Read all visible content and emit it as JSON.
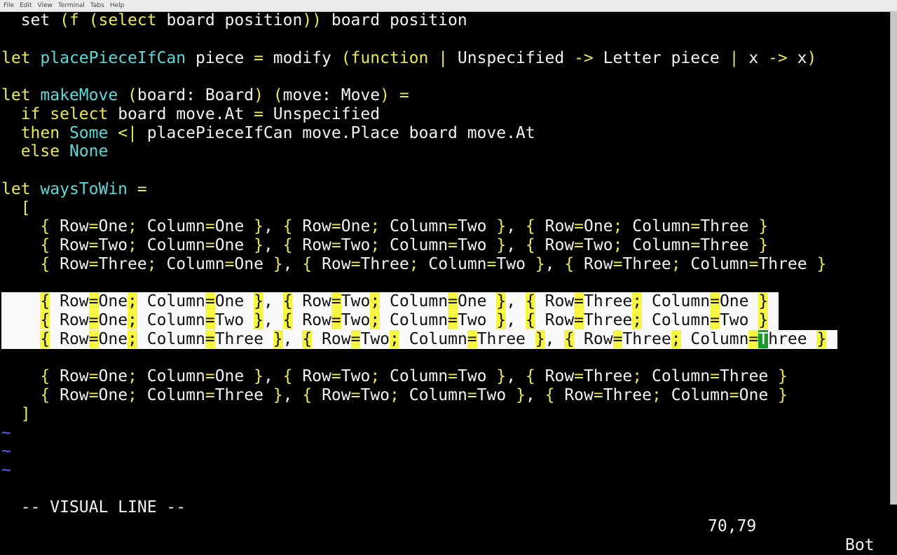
{
  "menu": [
    "File",
    "Edit",
    "View",
    "Terminal",
    "Tabs",
    "Help"
  ],
  "colors": {
    "keyword": "#e8e85a",
    "identifier": "#5ed8d8",
    "text": "#f2f2f2",
    "tilde": "#5f5fff",
    "selection_bg": "#fafafa",
    "match_bg": "#f5f542",
    "cursor_bg": "#1a9a2a"
  },
  "editor": {
    "lines": [
      "  set (f (select board position)) board position",
      "",
      "let placePieceIfCan piece = modify (function | Unspecified -> Letter piece | x -> x)",
      "",
      "let makeMove (board: Board) (move: Move) =",
      "  if select board move.At = Unspecified",
      "  then Some <| placePieceIfCan move.Place board move.At",
      "  else None",
      "",
      "let waysToWin =",
      "  [",
      "    { Row=One; Column=One }, { Row=One; Column=Two }, { Row=One; Column=Three }",
      "    { Row=Two; Column=One }, { Row=Two; Column=Two }, { Row=Two; Column=Three }",
      "    { Row=Three; Column=One }, { Row=Three; Column=Two }, { Row=Three; Column=Three }",
      "",
      "    { Row=One; Column=One }, { Row=Two; Column=One }, { Row=Three; Column=One }",
      "    { Row=One; Column=Two }, { Row=Two; Column=Two }, { Row=Three; Column=Two }",
      "    { Row=One; Column=Three }, { Row=Two; Column=Three }, { Row=Three; Column=Three }",
      "",
      "    { Row=One; Column=One }, { Row=Two; Column=Two }, { Row=Three; Column=Three }",
      "    { Row=One; Column=Three }, { Row=Two; Column=Two }, { Row=Three; Column=One }",
      "  ]",
      "~",
      "~",
      "~"
    ],
    "selected_lines": [
      15,
      16,
      17
    ],
    "cursor": {
      "line": 17,
      "col": 78
    },
    "keywords": [
      "let",
      "if",
      "then",
      "else",
      "function",
      "select",
      "f"
    ],
    "identifiers_after_let": true,
    "constructors": [
      "Some",
      "None"
    ]
  },
  "status": {
    "mode": "-- VISUAL LINE --",
    "position": "70,79",
    "scroll": "Bot"
  }
}
